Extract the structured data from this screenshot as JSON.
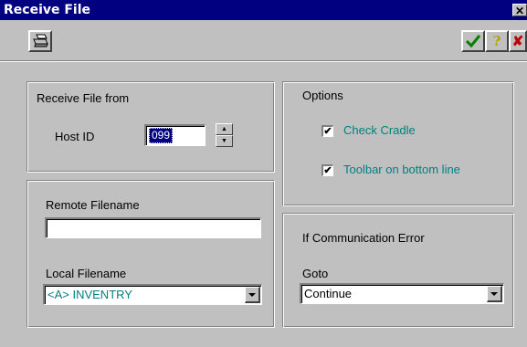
{
  "window": {
    "title": "Receive File",
    "close_glyph": "✕"
  },
  "toolbar": {
    "left_icon": "printer-icon",
    "right_icons": [
      "ok-check-icon",
      "help-question-icon",
      "cancel-x-icon"
    ],
    "help_glyph": "?",
    "cancel_glyph": "✘"
  },
  "receive_from": {
    "group_label": "Receive File from",
    "host_label": "Host ID",
    "host_value": "099",
    "spin_up": "▲",
    "spin_down": "▼"
  },
  "options": {
    "group_label": "Options",
    "items": [
      {
        "label": "Check Cradle",
        "checked": true,
        "mark": "✔"
      },
      {
        "label": "Toolbar on bottom line",
        "checked": true,
        "mark": "✔"
      }
    ]
  },
  "files": {
    "remote_label": "Remote Filename",
    "remote_value": "",
    "local_label": "Local Filename",
    "local_value": "<A> INVENTRY"
  },
  "comm_error": {
    "group_label": "If Communication Error",
    "goto_label": "Goto",
    "goto_value": "Continue"
  },
  "colors": {
    "titlebar": "#000080",
    "face": "#c0c0c0",
    "teal_text": "#008080"
  }
}
